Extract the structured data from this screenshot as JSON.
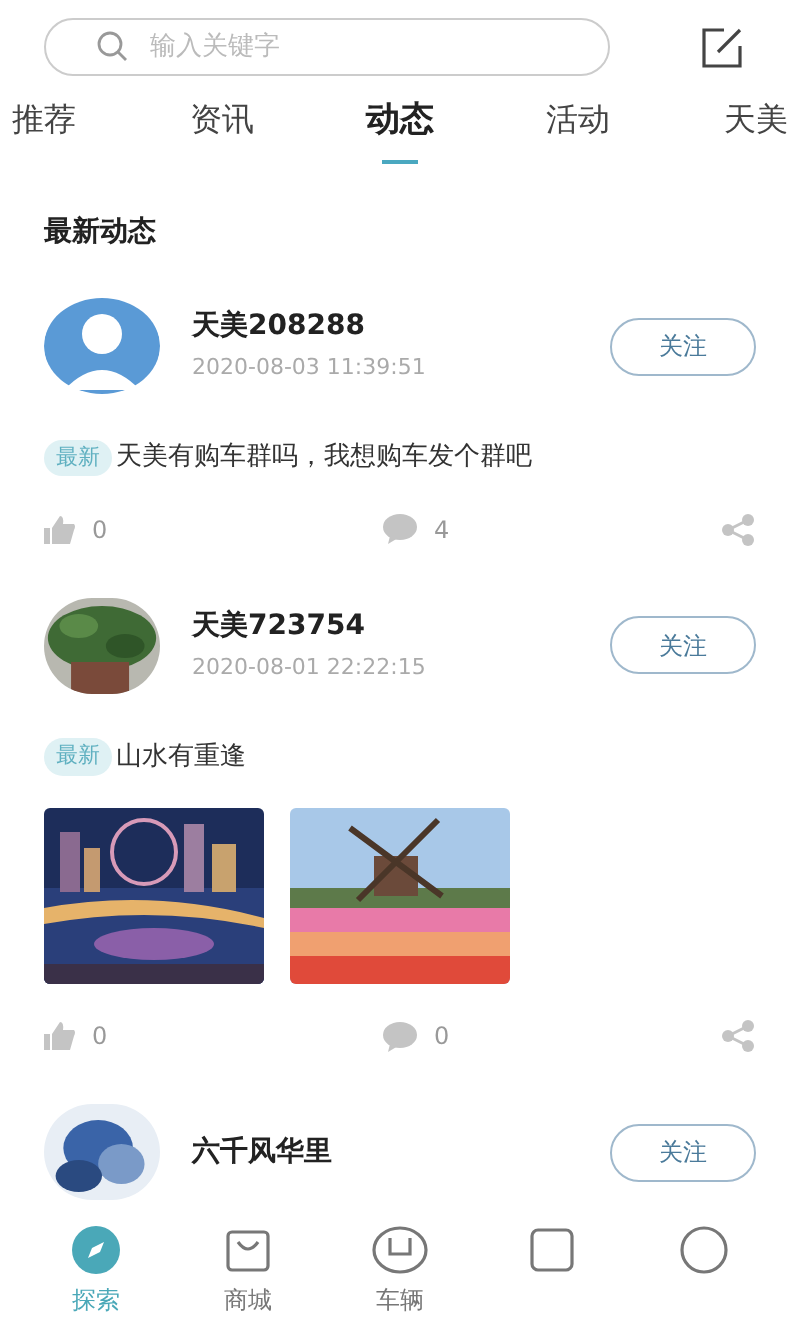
{
  "search": {
    "placeholder": "输入关键字"
  },
  "tabs": [
    {
      "label": "推荐",
      "selected": false
    },
    {
      "label": "资讯",
      "selected": false
    },
    {
      "label": "动态",
      "selected": true
    },
    {
      "label": "活动",
      "selected": false
    },
    {
      "label": "天美",
      "selected": false
    }
  ],
  "section_title": "最新动态",
  "posts": [
    {
      "name": "天美208288",
      "time": "2020-08-03 11:39:51",
      "follow": "关注",
      "tag": "最新",
      "text": "天美有购车群吗，我想购车发个群吧",
      "likes": "0",
      "comments": "4"
    },
    {
      "name": "天美723754",
      "time": "2020-08-01 22:22:15",
      "follow": "关注",
      "tag": "最新",
      "text": "山水有重逢",
      "likes": "0",
      "comments": "0"
    },
    {
      "name": "六千风华里",
      "follow": "关注"
    }
  ],
  "nav": [
    {
      "label": "探索",
      "selected": true
    },
    {
      "label": "商城",
      "selected": false
    },
    {
      "label": "车辆",
      "selected": false
    },
    {
      "selected": false
    },
    {
      "selected": false
    }
  ]
}
